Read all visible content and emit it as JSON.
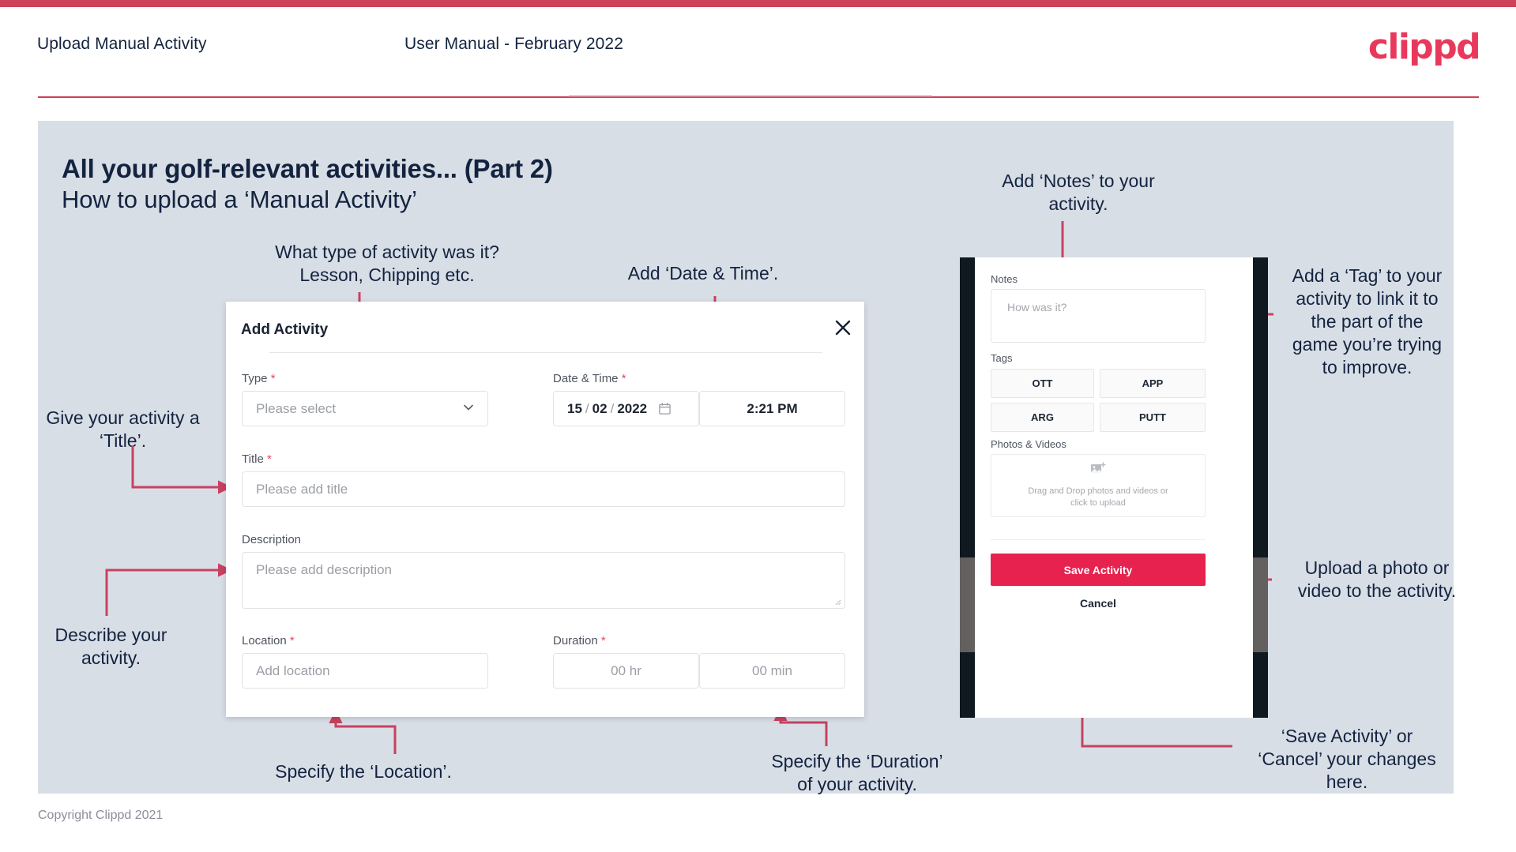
{
  "header": {
    "title": "Upload Manual Activity",
    "subtitle": "User Manual - February 2022",
    "logo": "clippd"
  },
  "slide": {
    "title": "All your golf-relevant activities... (Part 2)",
    "subtitle": "How to upload a ‘Manual Activity’",
    "copyright": "Copyright Clippd 2021"
  },
  "dialog": {
    "title": "Add Activity",
    "close_icon": "close-icon",
    "fields": {
      "type": {
        "label": "Type",
        "required": "*",
        "placeholder": "Please select"
      },
      "datetime": {
        "label": "Date & Time",
        "required": "*",
        "day": "15",
        "month": "02",
        "year": "2022",
        "sep": "/",
        "time": "2:21 PM"
      },
      "title": {
        "label": "Title",
        "required": "*",
        "placeholder": "Please add title"
      },
      "description": {
        "label": "Description",
        "placeholder": "Please add description"
      },
      "location": {
        "label": "Location",
        "required": "*",
        "placeholder": "Add location"
      },
      "duration": {
        "label": "Duration",
        "required": "*",
        "hours_placeholder": "00 hr",
        "minutes_placeholder": "00 min"
      }
    }
  },
  "phone": {
    "notes": {
      "label": "Notes",
      "placeholder": "How was it?"
    },
    "tags": {
      "label": "Tags",
      "items": [
        "OTT",
        "APP",
        "ARG",
        "PUTT"
      ]
    },
    "photos": {
      "label": "Photos & Videos",
      "drop_line1": "Drag and Drop photos and videos or",
      "drop_line2": "click to upload",
      "icon": "add-image-icon"
    },
    "save_label": "Save Activity",
    "cancel_label": "Cancel"
  },
  "annotations": {
    "type": "What type of activity was it?\nLesson, Chipping etc.",
    "datetime": "Add ‘Date & Time’.",
    "title": "Give your activity a\n‘Title’.",
    "description": "Describe your\nactivity.",
    "location": "Specify the ‘Location’.",
    "duration": "Specify the ‘Duration’\nof your activity.",
    "notes": "Add ‘Notes’ to your\nactivity.",
    "tags": "Add a ‘Tag’ to your\nactivity to link it to\nthe part of the\ngame you’re trying\nto improve.",
    "photos": "Upload a photo or\nvideo to the activity.",
    "save": "‘Save Activity’ or\n‘Cancel’ your changes\nhere."
  },
  "colors": {
    "brand_red": "#e8395c",
    "accent_rule": "#cf4059",
    "arrow": "#c94160",
    "panel_bg": "#d8dee6",
    "save_button": "#e8224f",
    "text_dark": "#13233f"
  }
}
